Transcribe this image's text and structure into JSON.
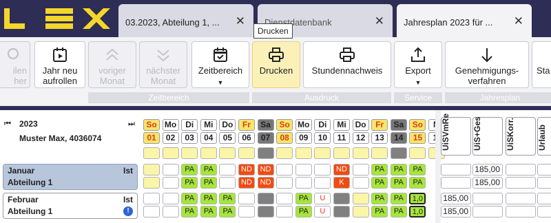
{
  "app": {
    "logo_text": "LEX"
  },
  "tabs": [
    {
      "label": "03.2023, Abteilung 1, ...",
      "close": "✕",
      "active": false
    },
    {
      "label": "Dienstdatenbank",
      "close": "✕",
      "active": false
    },
    {
      "label": "Jahresplan 2023 für ...",
      "close": "✕",
      "active": true
    }
  ],
  "tooltip": "Drucken",
  "ribbon": {
    "partial_left_label": "ilen\nher",
    "buttons": [
      {
        "label": "Jahr neu\naufrollen",
        "icon": "calendar-play-icon",
        "disabled": false
      },
      {
        "label": "voriger\nMonat",
        "icon": "chevrons-up-icon",
        "disabled": true
      },
      {
        "label": "nächster\nMonat",
        "icon": "chevrons-down-icon",
        "disabled": true
      },
      {
        "label": "Zeitbereich",
        "icon": "calendar-check-icon",
        "disabled": false,
        "dropdown": "▼"
      },
      {
        "label": "Drucken",
        "icon": "printer-icon",
        "disabled": false
      },
      {
        "label": "Stundennachweis",
        "icon": "printer-icon",
        "disabled": false
      },
      {
        "label": "Export",
        "icon": "upload-icon",
        "disabled": false,
        "dropdown": "▼"
      },
      {
        "label": "Genehmigungs-\nverfahren",
        "icon": "arrow-down-icon",
        "disabled": false
      },
      {
        "label": "Sta",
        "icon": "",
        "disabled": false
      }
    ],
    "groups": [
      "Zeitbereich",
      "Ausdruck",
      "Service",
      "Jahresplan"
    ]
  },
  "grid": {
    "year": "2023",
    "person": "Muster Max, 4036074",
    "nav_prev": "⏮",
    "nav_next": "⏭",
    "weekdays": [
      "So",
      "Mo",
      "Di",
      "Mi",
      "Do",
      "Fr",
      "Sa",
      "So",
      "Mo",
      "Di",
      "Mi",
      "Do",
      "Fr",
      "Sa",
      "So",
      "M"
    ],
    "daynums": [
      "01",
      "02",
      "03",
      "04",
      "05",
      "06",
      "07",
      "08",
      "09",
      "10",
      "11",
      "12",
      "13",
      "14",
      "15",
      "1("
    ],
    "columns": [
      "UiSVmRe",
      "UiS+Ges",
      "UiSKorr.",
      "Urlaub"
    ],
    "months": [
      {
        "name": "Januar",
        "dept": "Abteilung 1",
        "ist": "Ist",
        "selected": true,
        "row1": [
          "Y",
          "",
          "PA",
          "PA",
          "",
          "ND",
          "ND",
          "",
          "",
          "",
          "ND",
          "",
          "PA",
          "PA",
          "PA"
        ],
        "row2": [
          "Y",
          "",
          "PA",
          "PA",
          "",
          "ND",
          "ND",
          "",
          "",
          "",
          "K",
          "",
          "PA",
          "PA",
          "PA"
        ],
        "vals1": [
          "",
          "185,00",
          "",
          ""
        ],
        "vals2": [
          "",
          "185,00",
          "",
          ""
        ]
      },
      {
        "name": "Februar",
        "dept": "Abteilung 1",
        "ist": "Ist",
        "info": "!",
        "selected": false,
        "row1": [
          "",
          "",
          "PA",
          "PA",
          "PA",
          "",
          "G",
          "",
          "PA",
          "U",
          "G",
          "Y",
          "PA",
          "PA",
          "1,0"
        ],
        "row2": [
          "",
          "",
          "PA",
          "PA",
          "PA",
          "",
          "G",
          "",
          "PA",
          "U",
          "G",
          "Y",
          "PA",
          "PA",
          "1,0"
        ],
        "vals1": [
          "185,00",
          "",
          "",
          ""
        ],
        "vals2": [
          "185,00",
          "",
          "",
          ""
        ]
      }
    ]
  }
}
